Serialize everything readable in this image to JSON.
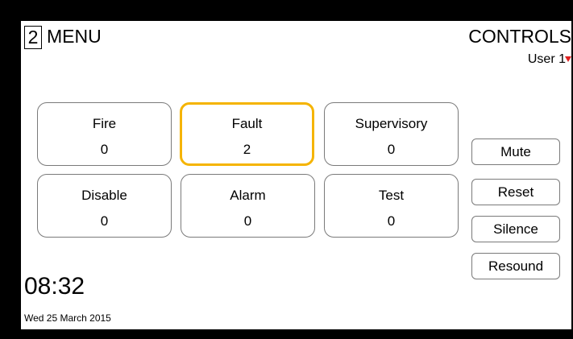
{
  "header": {
    "menu_number": "2",
    "menu_label": "MENU",
    "title": "CONTROLS",
    "user": "User 1"
  },
  "tiles": [
    {
      "label": "Fire",
      "value": "0",
      "selected": false
    },
    {
      "label": "Fault",
      "value": "2",
      "selected": true
    },
    {
      "label": "Supervisory",
      "value": "0",
      "selected": false
    },
    {
      "label": "Disable",
      "value": "0",
      "selected": false
    },
    {
      "label": "Alarm",
      "value": "0",
      "selected": false
    },
    {
      "label": "Test",
      "value": "0",
      "selected": false
    }
  ],
  "controls": {
    "mute": "Mute",
    "reset": "Reset",
    "silence": "Silence",
    "resound": "Resound"
  },
  "status": {
    "time": "08:32",
    "date": "Wed 25 March 2015"
  },
  "colors": {
    "selected_border": "#f5b400",
    "user_marker": "#e02020",
    "bezel": "#000000"
  }
}
